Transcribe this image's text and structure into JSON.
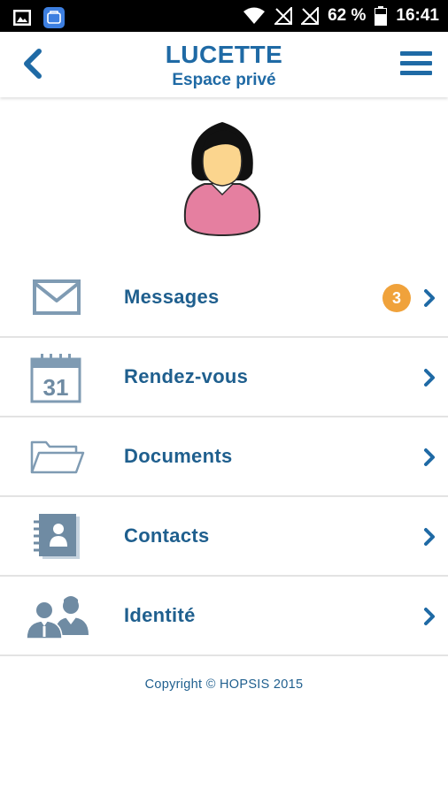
{
  "status_bar": {
    "battery": "62 %",
    "time": "16:41"
  },
  "header": {
    "title": "LUCETTE",
    "subtitle": "Espace privé"
  },
  "menu": {
    "items": [
      {
        "label": "Messages",
        "icon": "envelope-icon",
        "badge": "3"
      },
      {
        "label": "Rendez-vous",
        "icon": "calendar-icon",
        "calendar_day": "31"
      },
      {
        "label": "Documents",
        "icon": "folder-icon"
      },
      {
        "label": "Contacts",
        "icon": "address-book-icon"
      },
      {
        "label": "Identité",
        "icon": "people-icon"
      }
    ]
  },
  "footer": {
    "copyright": "Copyright © HOPSIS 2015"
  },
  "colors": {
    "accent": "#1f6aa5",
    "label": "#1f5f8e",
    "icon_grey": "#7f9bb3",
    "badge": "#f0a23b"
  }
}
